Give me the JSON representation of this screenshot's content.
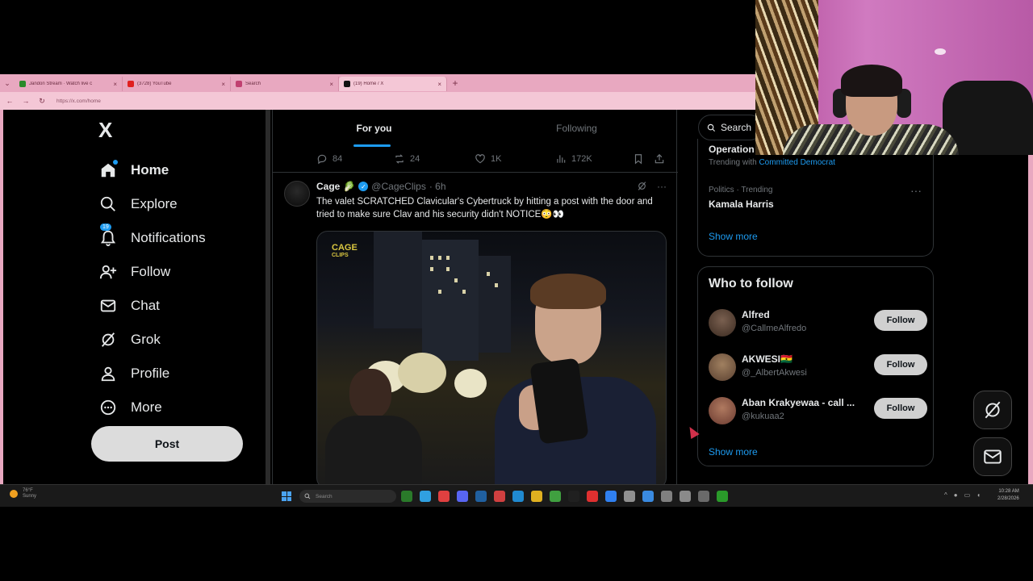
{
  "browser": {
    "tabs": [
      {
        "title": "Jandon Stream · Watch live c",
        "favicon": "#2a8a2a"
      },
      {
        "title": "(3728) YouTube",
        "favicon": "#e02020"
      },
      {
        "title": "Search",
        "favicon": "#c04070"
      },
      {
        "title": "(19) Home / X",
        "favicon": "#111111"
      }
    ],
    "url": "https://x.com/home"
  },
  "sidebar": {
    "logo": "X",
    "items": [
      {
        "label": "Home",
        "icon": "home-icon"
      },
      {
        "label": "Explore",
        "icon": "search-icon"
      },
      {
        "label": "Notifications",
        "icon": "bell-icon",
        "badge": "19"
      },
      {
        "label": "Follow",
        "icon": "add-person-icon"
      },
      {
        "label": "Chat",
        "icon": "mail-icon"
      },
      {
        "label": "Grok",
        "icon": "grok-icon"
      },
      {
        "label": "Profile",
        "icon": "person-icon"
      },
      {
        "label": "More",
        "icon": "more-circle-icon"
      }
    ],
    "post_label": "Post"
  },
  "feed": {
    "tabs": [
      "For you",
      "Following"
    ],
    "prev_actions": {
      "replies": "84",
      "reposts": "24",
      "likes": "1K",
      "views": "172K"
    },
    "tweet": {
      "name": "Cage",
      "emoji": "🥬",
      "handle": "@CageClips",
      "time": "· 6h",
      "text": "The valet SCRATCHED Clavicular's Cybertruck by hitting a post with the door and tried to make sure Clav and his security didn't NOTICE😳👀",
      "media_logo": "CAGE",
      "media_logo_sub": "CLIPS"
    }
  },
  "right": {
    "search_label": "Search",
    "trend1": {
      "title": "Operation",
      "meta_prefix": "Trending with",
      "meta_link": "Committed Democrat"
    },
    "trend2": {
      "category": "Politics · Trending",
      "title": "Kamala Harris"
    },
    "show_more": "Show more",
    "who_to_follow": {
      "title": "Who to follow",
      "people": [
        {
          "name": "Alfred",
          "handle": "@CallmeAlfredo",
          "avatar_color": "#5a4a3a"
        },
        {
          "name": "AKWESI🇬🇭",
          "handle": "@_AlbertAkwesi",
          "avatar_color": "#7a6050"
        },
        {
          "name": "Aban Krakyewaa - call ...",
          "handle": "@kukuaa2",
          "avatar_color": "#8a5a48"
        }
      ],
      "follow_label": "Follow",
      "show_more": "Show more"
    }
  },
  "taskbar": {
    "weather_temp": "76°F",
    "weather_desc": "Sunny",
    "search_placeholder": "Search",
    "time": "10:28 AM",
    "date": "2/28/2026",
    "app_colors": [
      "#2a7a2a",
      "#30a0e0",
      "#e04040",
      "#5865f2",
      "#2060a0",
      "#d04040",
      "#208ad0",
      "#e0b020",
      "#40a040",
      "#202020",
      "#e03030",
      "#3080f0",
      "#909090",
      "#3a8ae0",
      "#808080",
      "#8a8a8a",
      "#6a6a6a",
      "#2a9a2a"
    ]
  },
  "colors": {
    "accent": "#1d9bf0",
    "chrome_pink": "#e8a8c0",
    "background": "#000000"
  }
}
